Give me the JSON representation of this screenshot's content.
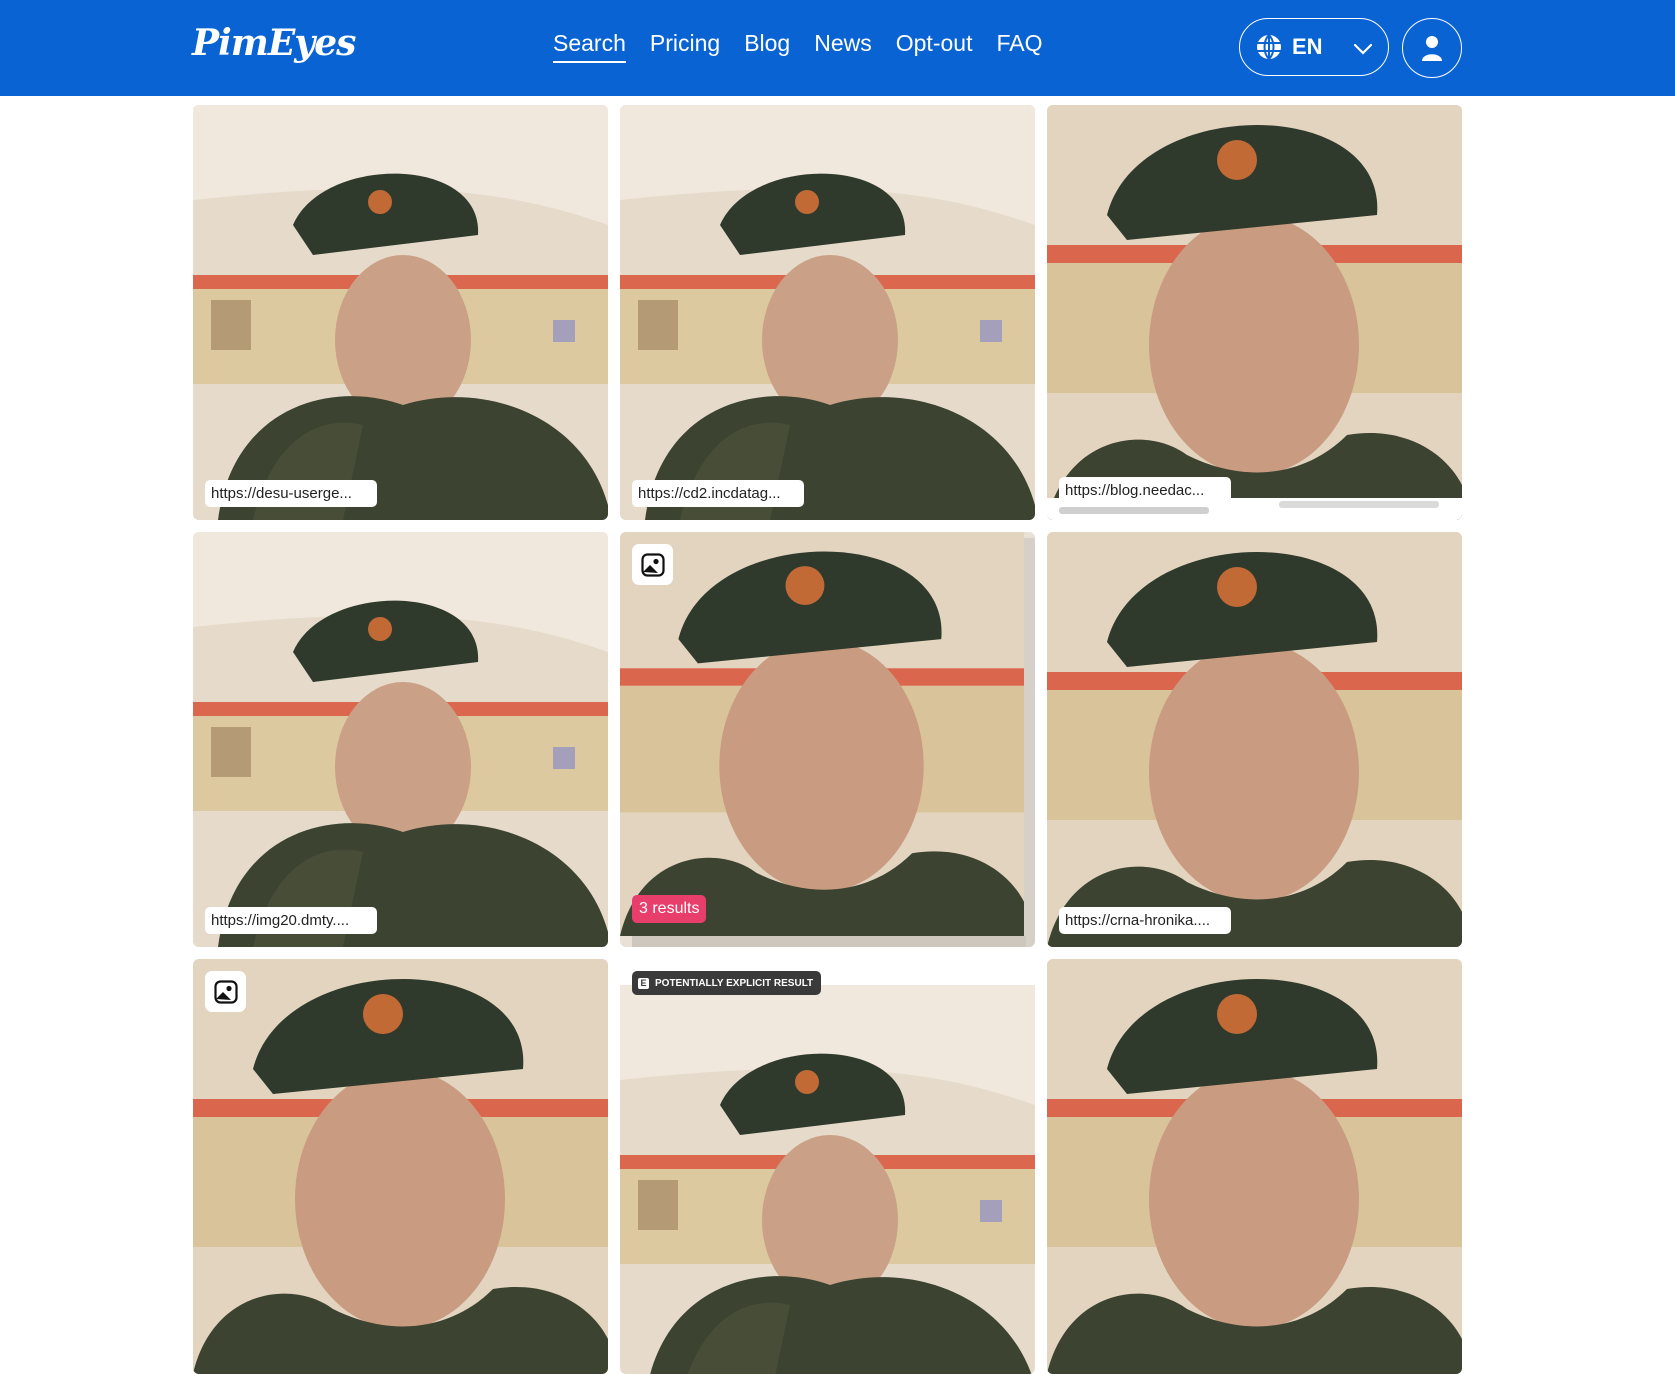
{
  "app": {
    "logo_text": "PimEyes"
  },
  "nav": {
    "items": [
      {
        "label": "Search",
        "active": true
      },
      {
        "label": "Pricing",
        "active": false
      },
      {
        "label": "Blog",
        "active": false
      },
      {
        "label": "News",
        "active": false
      },
      {
        "label": "Opt-out",
        "active": false
      },
      {
        "label": "FAQ",
        "active": false
      }
    ]
  },
  "language": {
    "selected": "EN",
    "icon": "globe-icon",
    "dropdown_icon": "chevron-down-icon"
  },
  "account": {
    "icon": "user-icon"
  },
  "results": [
    {
      "url": "https://desu-userge...",
      "variant": "wide"
    },
    {
      "url": "https://cd2.incdatag...",
      "variant": "wide"
    },
    {
      "url": "https://blog.needac...",
      "variant": "close"
    },
    {
      "url": "https://img20.dmty....",
      "variant": "wide"
    },
    {
      "url": "",
      "variant": "close",
      "image_badge": "image-icon",
      "results_count": "3 results"
    },
    {
      "url": "https://crna-hronika....",
      "variant": "close"
    },
    {
      "url": "",
      "variant": "close",
      "image_badge": "image-icon"
    },
    {
      "url": "",
      "variant": "wide",
      "explicit_label": "POTENTIALLY EXPLICIT RESULT",
      "explicit_icon": "E"
    },
    {
      "url": "",
      "variant": "close"
    }
  ],
  "colors": {
    "header_bg": "#0a63d3",
    "results_badge": "#e83e6b",
    "explicit_badge": "#3a3a3a"
  }
}
